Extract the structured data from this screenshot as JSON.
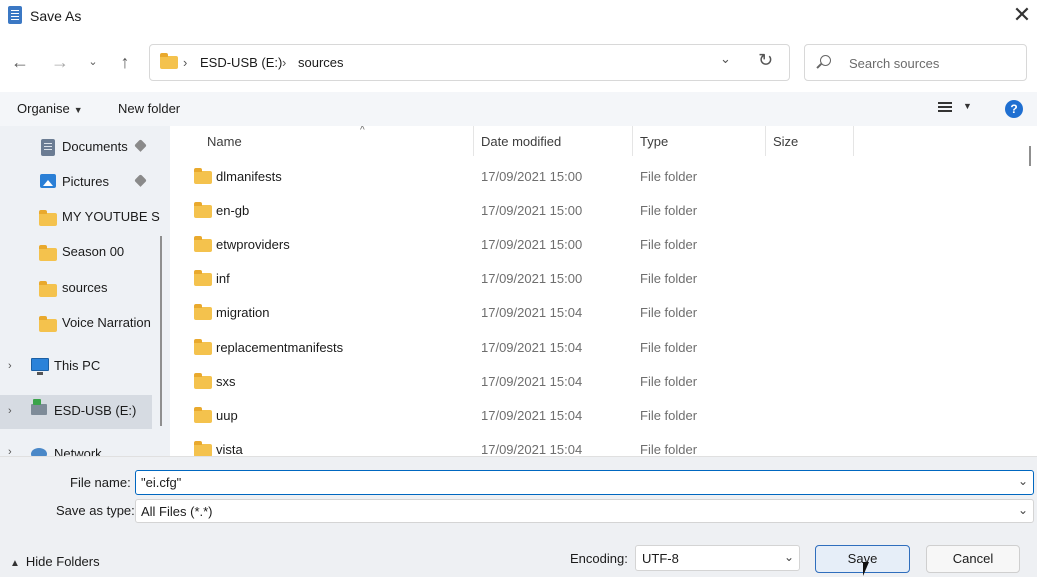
{
  "window": {
    "title": "Save As",
    "close_icon": "close-icon"
  },
  "nav": {
    "back_icon": "arrow-left-icon",
    "forward_icon": "arrow-right-icon",
    "recent_icon": "chevron-down-icon",
    "up_icon": "arrow-up-icon",
    "breadcrumb": [
      "ESD-USB (E:)",
      "sources"
    ],
    "breadcrumb_sep": "›",
    "refresh_icon": "refresh-icon",
    "search_placeholder": "Search sources"
  },
  "commandbar": {
    "organise_label": "Organise",
    "new_folder_label": "New folder",
    "help_label": "?"
  },
  "sidebar": {
    "items": [
      {
        "label": "Documents",
        "icon": "documents-icon",
        "pinned": true
      },
      {
        "label": "Pictures",
        "icon": "pictures-icon",
        "pinned": true
      },
      {
        "label": "MY YOUTUBE S",
        "icon": "folder-icon"
      },
      {
        "label": "Season 00",
        "icon": "folder-icon"
      },
      {
        "label": "sources",
        "icon": "folder-icon"
      },
      {
        "label": "Voice Narration",
        "icon": "folder-icon"
      },
      {
        "label": "This PC",
        "icon": "pc-icon"
      },
      {
        "label": "ESD-USB (E:)",
        "icon": "usb-drive-icon",
        "selected": true
      },
      {
        "label": "Network",
        "icon": "network-icon"
      }
    ]
  },
  "filelist": {
    "columns": [
      "Name",
      "Date modified",
      "Type",
      "Size"
    ],
    "rows": [
      {
        "name": "dlmanifests",
        "date": "17/09/2021 15:00",
        "type": "File folder"
      },
      {
        "name": "en-gb",
        "date": "17/09/2021 15:00",
        "type": "File folder"
      },
      {
        "name": "etwproviders",
        "date": "17/09/2021 15:00",
        "type": "File folder"
      },
      {
        "name": "inf",
        "date": "17/09/2021 15:00",
        "type": "File folder"
      },
      {
        "name": "migration",
        "date": "17/09/2021 15:04",
        "type": "File folder"
      },
      {
        "name": "replacementmanifests",
        "date": "17/09/2021 15:04",
        "type": "File folder"
      },
      {
        "name": "sxs",
        "date": "17/09/2021 15:04",
        "type": "File folder"
      },
      {
        "name": "uup",
        "date": "17/09/2021 15:04",
        "type": "File folder"
      },
      {
        "name": "vista",
        "date": "17/09/2021 15:04",
        "type": "File folder"
      }
    ]
  },
  "footer": {
    "filename_label": "File name:",
    "filename_value": "\"ei.cfg\"",
    "filetype_label": "Save as type:",
    "filetype_value": "All Files  (*.*)",
    "hide_folders_label": "Hide Folders",
    "encoding_label": "Encoding:",
    "encoding_value": "UTF-8",
    "save_label": "Save",
    "cancel_label": "Cancel"
  },
  "colors": {
    "accent": "#0067c0",
    "folder": "#f4c24d",
    "nav_bg": "#eef1f5"
  }
}
